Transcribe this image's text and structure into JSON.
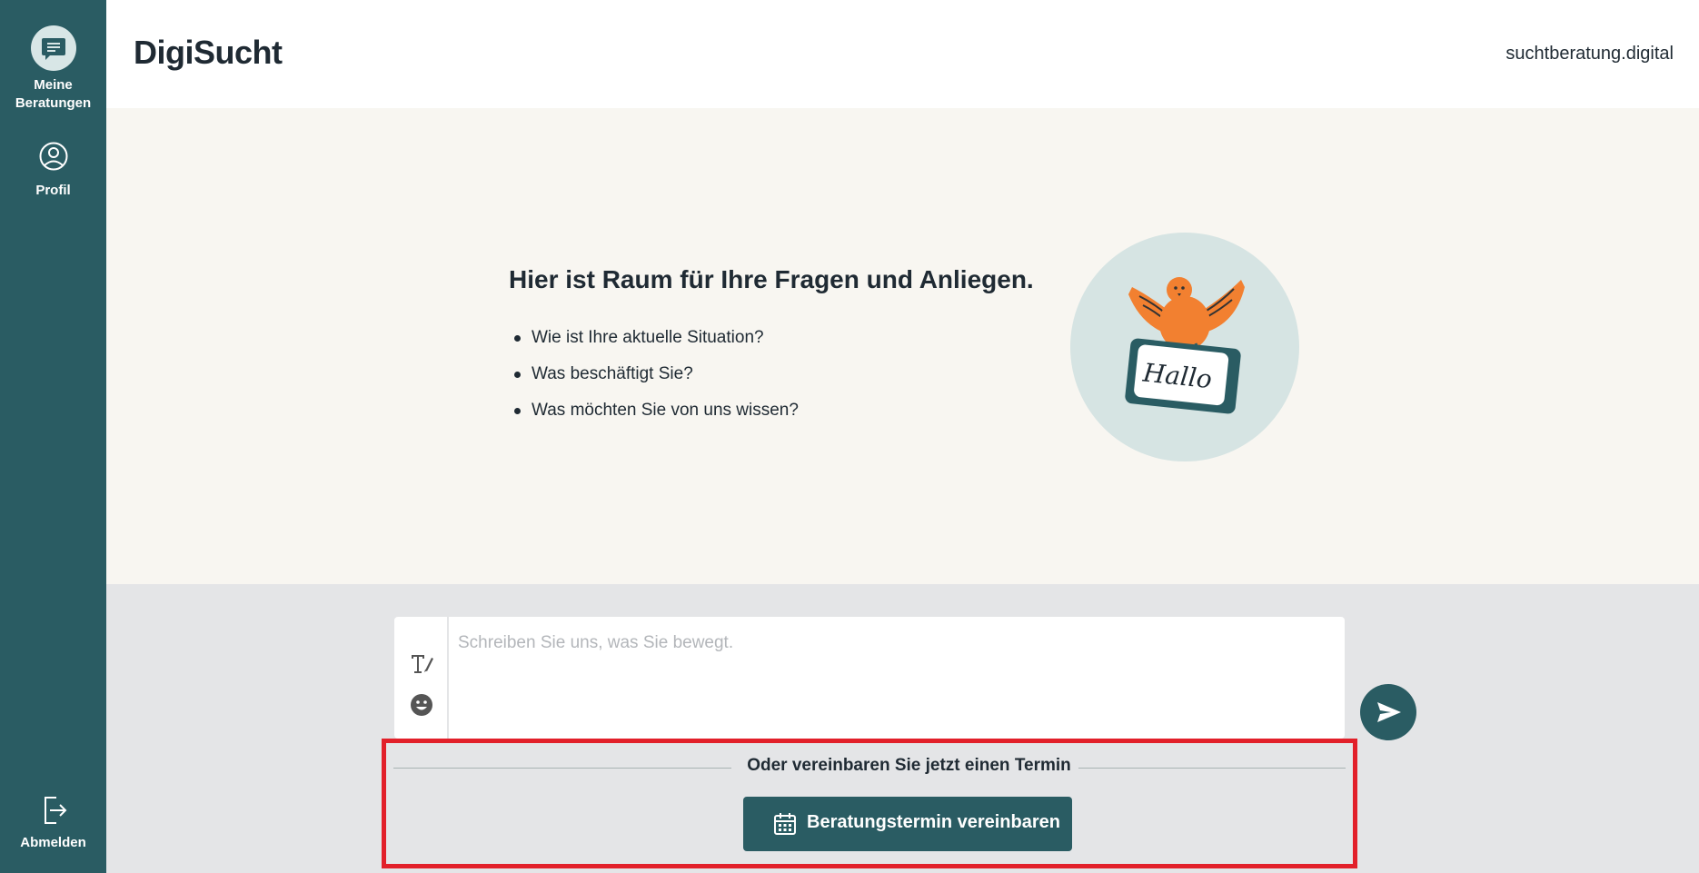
{
  "sidebar": {
    "items": [
      {
        "label_line1": "Meine",
        "label_line2": "Beratungen",
        "icon": "chat-bubble-icon"
      },
      {
        "label": "Profil",
        "icon": "user-circle-icon"
      }
    ],
    "logout": {
      "label": "Abmelden",
      "icon": "logout-icon"
    }
  },
  "header": {
    "brand": "DigiSucht",
    "site": "suchtberatung.digital"
  },
  "welcome": {
    "title": "Hier ist Raum für Ihre Fragen und Anliegen.",
    "questions": [
      "Wie ist Ihre aktuelle Situation?",
      "Was beschäftigt Sie?",
      "Was möchten Sie von uns wissen?"
    ],
    "illustration_sign_text": "Hallo"
  },
  "composer": {
    "placeholder": "Schreiben Sie uns, was Sie bewegt."
  },
  "appointment": {
    "divider_text": "Oder vereinbaren Sie jetzt einen Termin",
    "button_label": "Beratungstermin vereinbaren"
  },
  "colors": {
    "primary": "#2a5c63",
    "welcome_bg": "#f8f6f1",
    "composer_bg": "#e4e5e7",
    "bird_orange": "#f28030",
    "highlight_red": "#e2202a"
  }
}
